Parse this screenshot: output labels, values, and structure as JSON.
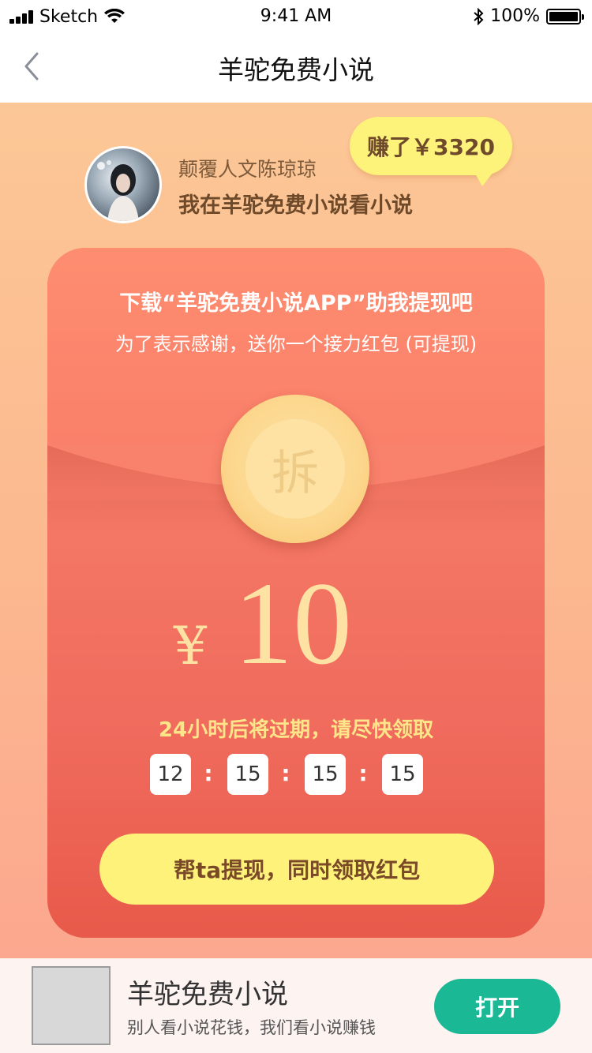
{
  "status_bar": {
    "carrier": "Sketch",
    "time": "9:41 AM",
    "battery": "100%",
    "icons": [
      "signal-icon",
      "wifi-icon",
      "bluetooth-icon",
      "battery-icon"
    ]
  },
  "nav": {
    "title": "羊驼免费小说",
    "back_icon": "chevron-left-icon"
  },
  "profile": {
    "name": "颠覆人文陈琼琼",
    "subtitle": "我在羊驼免费小说看小说",
    "earned": "赚了￥3320"
  },
  "packet": {
    "title": "下载“羊驼免费小说APP”助我提现吧",
    "subtitle": "为了表示感谢，送你一个接力红包 (可提现)",
    "open_label": "拆",
    "currency": "¥",
    "amount": "10",
    "expire_text": "24小时后将过期，请尽快领取",
    "countdown": [
      "12",
      "15",
      "15",
      "15"
    ],
    "separator": ":",
    "cta": "帮ta提现，同时领取红包"
  },
  "banner": {
    "app_name": "羊驼免费小说",
    "slogan": "别人看小说花钱，我们看小说赚钱",
    "open": "打开"
  },
  "colors": {
    "background_top": "#fcc796",
    "card_red": "#f06b5d",
    "coin_gold": "#fcd68c",
    "cta_yellow": "#fef27b",
    "open_green": "#1ab894"
  }
}
